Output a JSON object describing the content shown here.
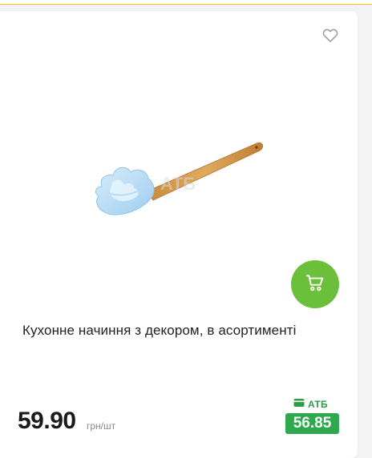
{
  "product": {
    "title": "Кухонне начиння з декором, в асортименті",
    "image_watermark": "АТБ"
  },
  "pricing": {
    "price": "59.90",
    "unit": "грн/шт",
    "atb_label": "АТБ",
    "atb_price": "56.85"
  },
  "icons": {
    "favorite": "heart-outline-icon",
    "cart": "shopping-cart-icon",
    "atb_card": "wallet-card-icon"
  },
  "colors": {
    "cart_button": "#6cbf3a",
    "atb_green": "#2fa84f",
    "accent_rule": "#f0c419"
  }
}
